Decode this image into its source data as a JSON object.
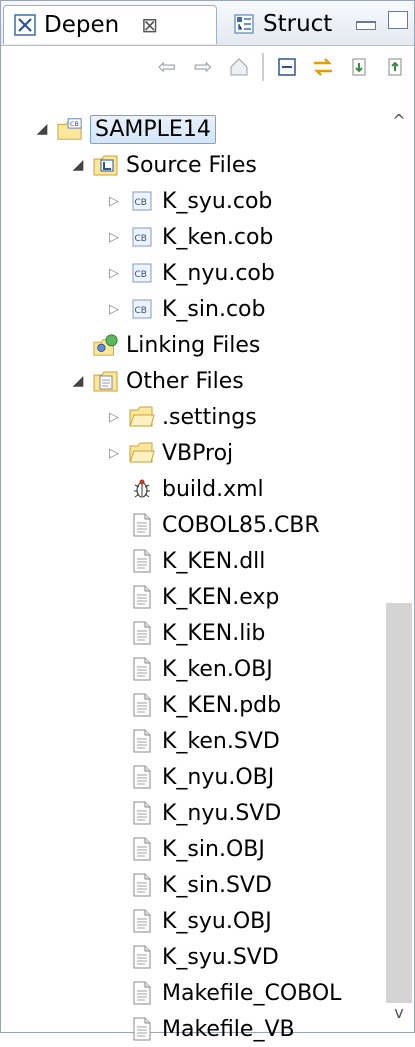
{
  "tabs": [
    {
      "label": "Depen",
      "close": "⊠"
    },
    {
      "label": "Struct"
    }
  ],
  "tree": [
    {
      "label": "SAMPLE14",
      "level": 0,
      "twisty": "open",
      "icon": "cobol-project-icon",
      "selected": true
    },
    {
      "label": "Source Files",
      "level": 1,
      "twisty": "open",
      "icon": "source-folder-icon"
    },
    {
      "label": "K_syu.cob",
      "level": 2,
      "twisty": "closed",
      "icon": "cob-file-icon"
    },
    {
      "label": "K_ken.cob",
      "level": 2,
      "twisty": "closed",
      "icon": "cob-file-icon"
    },
    {
      "label": "K_nyu.cob",
      "level": 2,
      "twisty": "closed",
      "icon": "cob-file-icon"
    },
    {
      "label": "K_sin.cob",
      "level": 2,
      "twisty": "closed",
      "icon": "cob-file-icon"
    },
    {
      "label": "Linking Files",
      "level": 1,
      "twisty": "none",
      "icon": "linking-files-icon"
    },
    {
      "label": "Other Files",
      "level": 1,
      "twisty": "open",
      "icon": "other-files-icon"
    },
    {
      "label": ".settings",
      "level": 2,
      "twisty": "closed",
      "icon": "folder-icon"
    },
    {
      "label": "VBProj",
      "level": 2,
      "twisty": "closed",
      "icon": "folder-icon"
    },
    {
      "label": "build.xml",
      "level": 2,
      "twisty": "none",
      "icon": "ant-file-icon"
    },
    {
      "label": "COBOL85.CBR",
      "level": 2,
      "twisty": "none",
      "icon": "text-file-icon"
    },
    {
      "label": "K_KEN.dll",
      "level": 2,
      "twisty": "none",
      "icon": "text-file-icon"
    },
    {
      "label": "K_KEN.exp",
      "level": 2,
      "twisty": "none",
      "icon": "text-file-icon"
    },
    {
      "label": "K_KEN.lib",
      "level": 2,
      "twisty": "none",
      "icon": "text-file-icon"
    },
    {
      "label": "K_ken.OBJ",
      "level": 2,
      "twisty": "none",
      "icon": "text-file-icon"
    },
    {
      "label": "K_KEN.pdb",
      "level": 2,
      "twisty": "none",
      "icon": "text-file-icon"
    },
    {
      "label": "K_ken.SVD",
      "level": 2,
      "twisty": "none",
      "icon": "text-file-icon"
    },
    {
      "label": "K_nyu.OBJ",
      "level": 2,
      "twisty": "none",
      "icon": "text-file-icon"
    },
    {
      "label": "K_nyu.SVD",
      "level": 2,
      "twisty": "none",
      "icon": "text-file-icon"
    },
    {
      "label": "K_sin.OBJ",
      "level": 2,
      "twisty": "none",
      "icon": "text-file-icon"
    },
    {
      "label": "K_sin.SVD",
      "level": 2,
      "twisty": "none",
      "icon": "text-file-icon"
    },
    {
      "label": "K_syu.OBJ",
      "level": 2,
      "twisty": "none",
      "icon": "text-file-icon"
    },
    {
      "label": "K_syu.SVD",
      "level": 2,
      "twisty": "none",
      "icon": "text-file-icon"
    },
    {
      "label": "Makefile_COBOL",
      "level": 2,
      "twisty": "none",
      "icon": "text-file-icon"
    },
    {
      "label": "Makefile_VB",
      "level": 2,
      "twisty": "none",
      "icon": "text-file-icon"
    }
  ]
}
